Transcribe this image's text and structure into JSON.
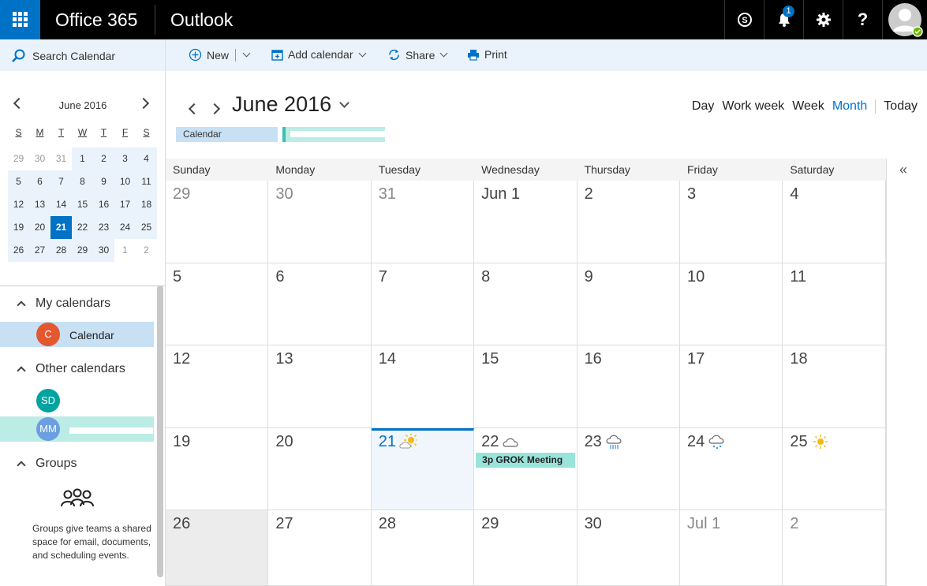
{
  "header": {
    "brand": "Office 365",
    "app": "Outlook",
    "notifications_count": "1",
    "help_label": "?"
  },
  "toolbar": {
    "search_label": "Search Calendar",
    "new_label": "New",
    "add_calendar_label": "Add calendar",
    "share_label": "Share",
    "print_label": "Print"
  },
  "mini_calendar": {
    "title": "June 2016",
    "day_headers": [
      "S",
      "M",
      "T",
      "W",
      "T",
      "F",
      "S"
    ],
    "days": [
      {
        "d": "29",
        "o": true
      },
      {
        "d": "30",
        "o": true
      },
      {
        "d": "31",
        "o": true
      },
      {
        "d": "1"
      },
      {
        "d": "2"
      },
      {
        "d": "3"
      },
      {
        "d": "4"
      },
      {
        "d": "5"
      },
      {
        "d": "6"
      },
      {
        "d": "7"
      },
      {
        "d": "8"
      },
      {
        "d": "9"
      },
      {
        "d": "10"
      },
      {
        "d": "11"
      },
      {
        "d": "12"
      },
      {
        "d": "13"
      },
      {
        "d": "14"
      },
      {
        "d": "15"
      },
      {
        "d": "16"
      },
      {
        "d": "17"
      },
      {
        "d": "18"
      },
      {
        "d": "19"
      },
      {
        "d": "20"
      },
      {
        "d": "21",
        "t": true
      },
      {
        "d": "22"
      },
      {
        "d": "23"
      },
      {
        "d": "24"
      },
      {
        "d": "25"
      },
      {
        "d": "26"
      },
      {
        "d": "27"
      },
      {
        "d": "28"
      },
      {
        "d": "29"
      },
      {
        "d": "30"
      },
      {
        "d": "1",
        "o": true
      },
      {
        "d": "2",
        "o": true
      }
    ]
  },
  "sidebar": {
    "my_calendars": "My calendars",
    "calendar_item": {
      "initial": "C",
      "name": "Calendar",
      "color": "#e3572f"
    },
    "other_calendars": "Other calendars",
    "other_items": [
      {
        "initials": "SD",
        "color": "#00a3a0"
      },
      {
        "initials": "MM",
        "color": "#6c9fe0"
      }
    ],
    "groups": "Groups",
    "groups_text": "Groups give teams a shared space for email, documents, and scheduling events."
  },
  "main": {
    "month_title": "June 2016",
    "views": [
      "Day",
      "Work week",
      "Week",
      "Month"
    ],
    "active_view": "Month",
    "today_label": "Today",
    "calendar_tag": "Calendar",
    "weekday_headers": [
      "Sunday",
      "Monday",
      "Tuesday",
      "Wednesday",
      "Thursday",
      "Friday",
      "Saturday"
    ],
    "cells": [
      {
        "label": "29",
        "other": true
      },
      {
        "label": "30",
        "other": true
      },
      {
        "label": "31",
        "other": true
      },
      {
        "label": "Jun 1"
      },
      {
        "label": "2"
      },
      {
        "label": "3"
      },
      {
        "label": "4"
      },
      {
        "label": "5"
      },
      {
        "label": "6"
      },
      {
        "label": "7"
      },
      {
        "label": "8"
      },
      {
        "label": "9"
      },
      {
        "label": "10"
      },
      {
        "label": "11"
      },
      {
        "label": "12"
      },
      {
        "label": "13"
      },
      {
        "label": "14"
      },
      {
        "label": "15"
      },
      {
        "label": "16"
      },
      {
        "label": "17"
      },
      {
        "label": "18"
      },
      {
        "label": "19"
      },
      {
        "label": "20"
      },
      {
        "label": "21",
        "today": true,
        "weather": "partly-sunny-icon"
      },
      {
        "label": "22",
        "weather": "cloudy-icon",
        "event": "3p GROK Meeting"
      },
      {
        "label": "23",
        "weather": "rain-icon"
      },
      {
        "label": "24",
        "weather": "snow-rain-icon"
      },
      {
        "label": "25",
        "weather": "sunny-icon"
      },
      {
        "label": "26",
        "gray": true
      },
      {
        "label": "27"
      },
      {
        "label": "28"
      },
      {
        "label": "29"
      },
      {
        "label": "30"
      },
      {
        "label": "Jul 1",
        "other": true
      },
      {
        "label": "2",
        "other": true
      }
    ]
  },
  "colors": {
    "accent": "#0072c6",
    "event": "#99e4da",
    "selected": "#c7e0f4"
  }
}
